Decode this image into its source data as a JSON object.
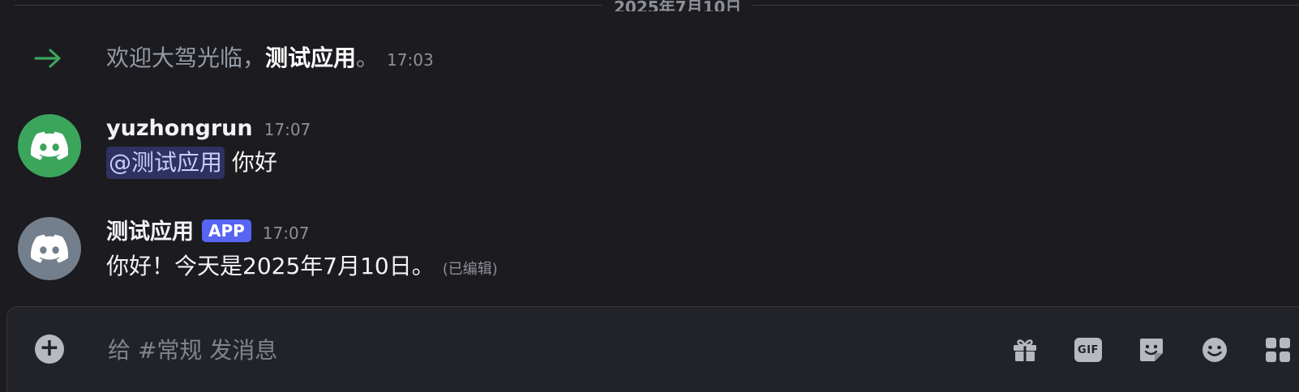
{
  "date_divider": "2025年7月10日",
  "welcome": {
    "prefix": "欢迎大驾光临，",
    "name": "测试应用",
    "suffix": "。",
    "time": "17:03"
  },
  "messages": [
    {
      "author": "yuzhongrun",
      "time": "17:07",
      "mention": "@测试应用",
      "text": "你好"
    },
    {
      "author": "测试应用",
      "badge": "APP",
      "time": "17:07",
      "text": "你好！今天是2025年7月10日。",
      "edited": "(已编辑)"
    }
  ],
  "composer": {
    "placeholder": "给 #常规 发消息",
    "gif_label": "GIF"
  },
  "colors": {
    "background": "#1b1b20",
    "join_arrow": "#3ba55c",
    "avatar_user": "#3ba55c",
    "avatar_app": "#747f8d",
    "app_badge": "#5865f2",
    "mention_bg": "#2e3260"
  },
  "icons": {
    "join": "arrow-right-icon",
    "avatar": "discord-logo-icon",
    "add": "plus-circle-icon",
    "gift": "gift-icon",
    "gif": "gif-icon",
    "sticker": "sticker-icon",
    "emoji": "emoji-icon",
    "apps": "apps-icon"
  }
}
